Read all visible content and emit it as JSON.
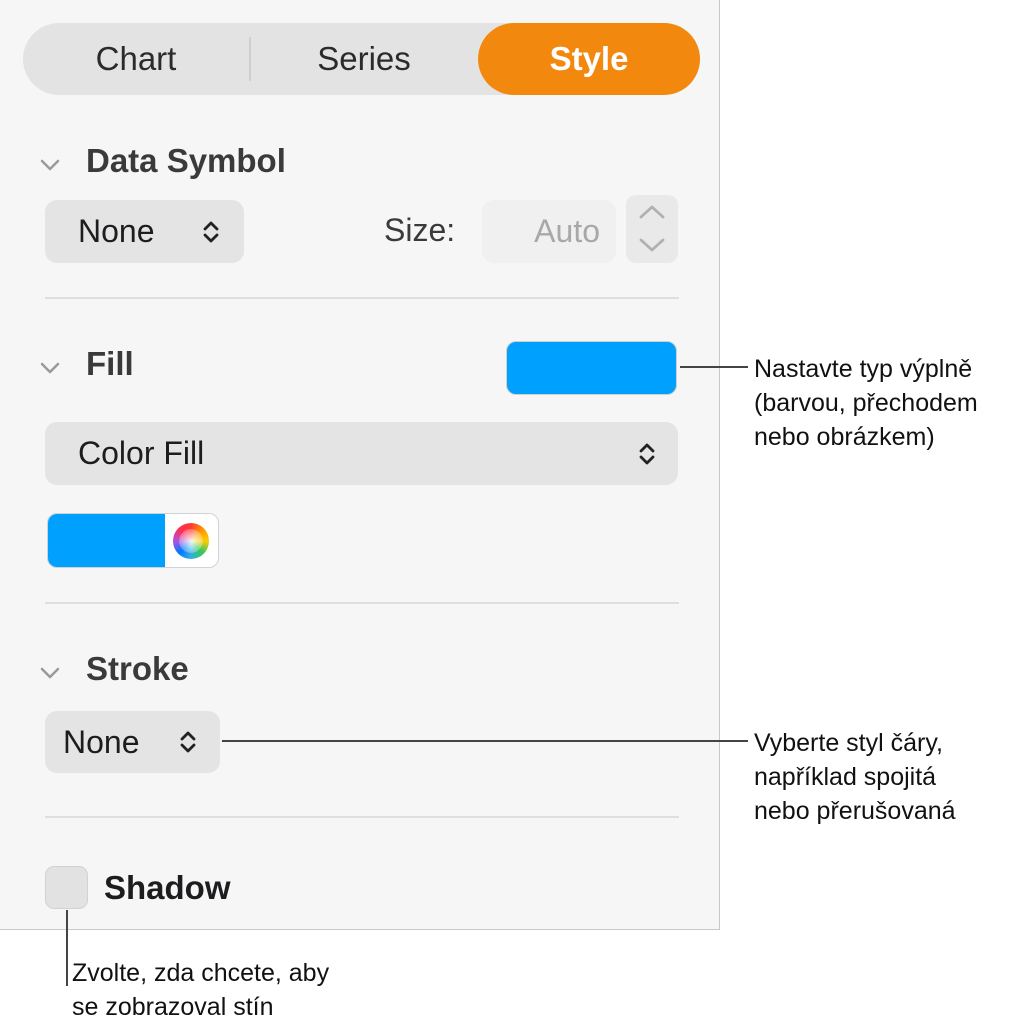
{
  "tabs": [
    {
      "label": "Chart"
    },
    {
      "label": "Series"
    },
    {
      "label": "Style"
    }
  ],
  "active_tab": "Style",
  "accent_color": "#f2890e",
  "data_symbol": {
    "title": "Data Symbol",
    "symbol_value": "None",
    "size_label": "Size:",
    "size_placeholder": "Auto"
  },
  "fill": {
    "title": "Fill",
    "swatch_color": "#00a0ff",
    "fill_type_value": "Color Fill",
    "well_color": "#00a0ff"
  },
  "stroke": {
    "title": "Stroke",
    "style_value": "None"
  },
  "shadow": {
    "label": "Shadow",
    "checked": false
  },
  "callouts": {
    "fill": [
      "Nastavte typ výplně",
      "(barvou, přechodem",
      "nebo obrázkem)"
    ],
    "stroke": [
      "Vyberte styl čáry,",
      "například spojitá",
      "nebo přerušovaná"
    ],
    "shadow": [
      "Zvolte, zda chcete, aby",
      "se zobrazoval stín"
    ]
  }
}
